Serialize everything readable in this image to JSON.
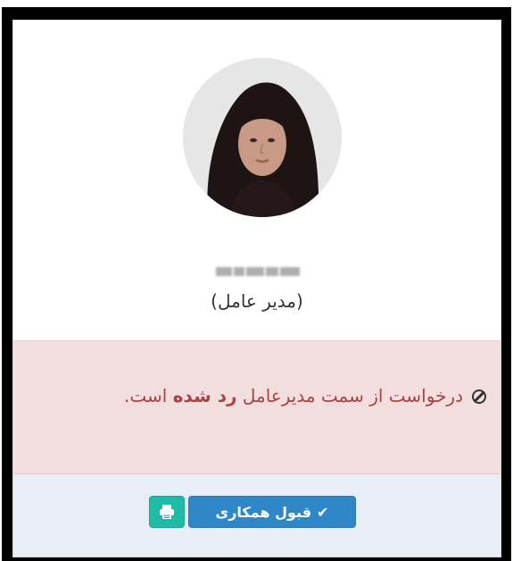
{
  "profile": {
    "name_blurred": "",
    "role": "(مدیر عامل)"
  },
  "alert": {
    "text_before_bold": "درخواست از سمت مدیرعامل ",
    "text_bold": "رد شده",
    "text_after_bold": " است.",
    "icon": "ban-icon"
  },
  "actions": {
    "accept_label": "قبول همکاری",
    "accept_icon": "check-icon",
    "print_icon": "print-icon"
  },
  "colors": {
    "alert_background": "#f2dede",
    "alert_text": "#a94442",
    "accept_button": "#2f87c8",
    "print_button": "#1fbba6",
    "footer_background": "#e8eef5"
  }
}
